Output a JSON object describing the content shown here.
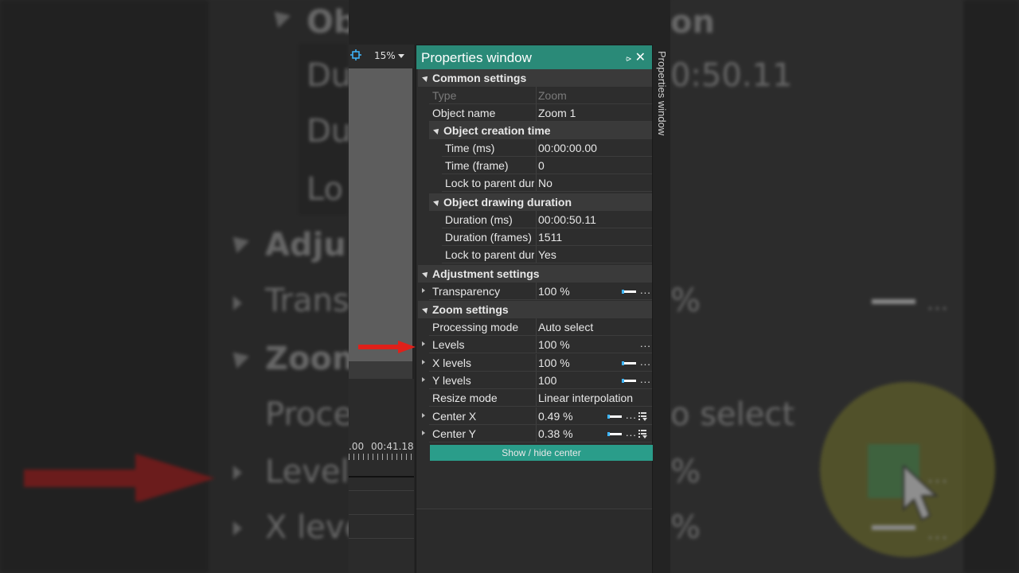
{
  "background": {
    "texts": {
      "object_header": "Ob",
      "duration_value": "Du",
      "duration_frames": "Du",
      "lock": "Lo",
      "adjustment": "Adju",
      "transparency": "Trans",
      "zoom": "Zoom",
      "processing": "Proce",
      "levels": "Level",
      "x_levels": "X leve",
      "zoom_right": "on",
      "duration_right": "0:50.11",
      "pct1": "%",
      "auto_select": "o select",
      "pct2": "%",
      "pct3": "%"
    }
  },
  "toolbar": {
    "zoom_value": "15%",
    "fit_icon": "fit-to-screen-icon"
  },
  "timeline": {
    "timecode_left": ".00",
    "timecode_right": "00:41.18"
  },
  "properties": {
    "title": "Properties window",
    "side_tab_label": "Properties window",
    "sections": {
      "common": "Common settings",
      "creation_time": "Object creation time",
      "drawing_duration": "Object drawing duration",
      "adjustment": "Adjustment settings",
      "zoom": "Zoom settings"
    },
    "rows": {
      "type": {
        "label": "Type",
        "value": "Zoom"
      },
      "object_name": {
        "label": "Object name",
        "value": "Zoom 1"
      },
      "time_ms": {
        "label": "Time (ms)",
        "value": "00:00:00.00"
      },
      "time_frame": {
        "label": "Time (frame)",
        "value": "0"
      },
      "lock_parent_1": {
        "label": "Lock to parent duration",
        "value": "No"
      },
      "duration_ms": {
        "label": "Duration (ms)",
        "value": "00:00:50.11"
      },
      "duration_frames": {
        "label": "Duration (frames)",
        "value": "1511"
      },
      "lock_parent_2": {
        "label": "Lock to parent duration",
        "value": "Yes"
      },
      "transparency": {
        "label": "Transparency",
        "value": "100 %"
      },
      "processing_mode": {
        "label": "Processing mode",
        "value": "Auto select"
      },
      "levels": {
        "label": "Levels",
        "value": "100 %"
      },
      "x_levels": {
        "label": "X levels",
        "value": "100 %"
      },
      "y_levels": {
        "label": "Y levels",
        "value": "100"
      },
      "resize_mode": {
        "label": "Resize mode",
        "value": "Linear interpolation"
      },
      "center_x": {
        "label": "Center X",
        "value": "0.49 %"
      },
      "center_y": {
        "label": "Center Y",
        "value": "0.38 %"
      }
    },
    "show_hide_center": "Show / hide center",
    "dots": "..."
  },
  "colors": {
    "accent_teal": "#2a8a78",
    "button_teal": "#2a9d8a",
    "arrow_red": "#e0201a",
    "highlight_yellow": "#b4be28"
  }
}
